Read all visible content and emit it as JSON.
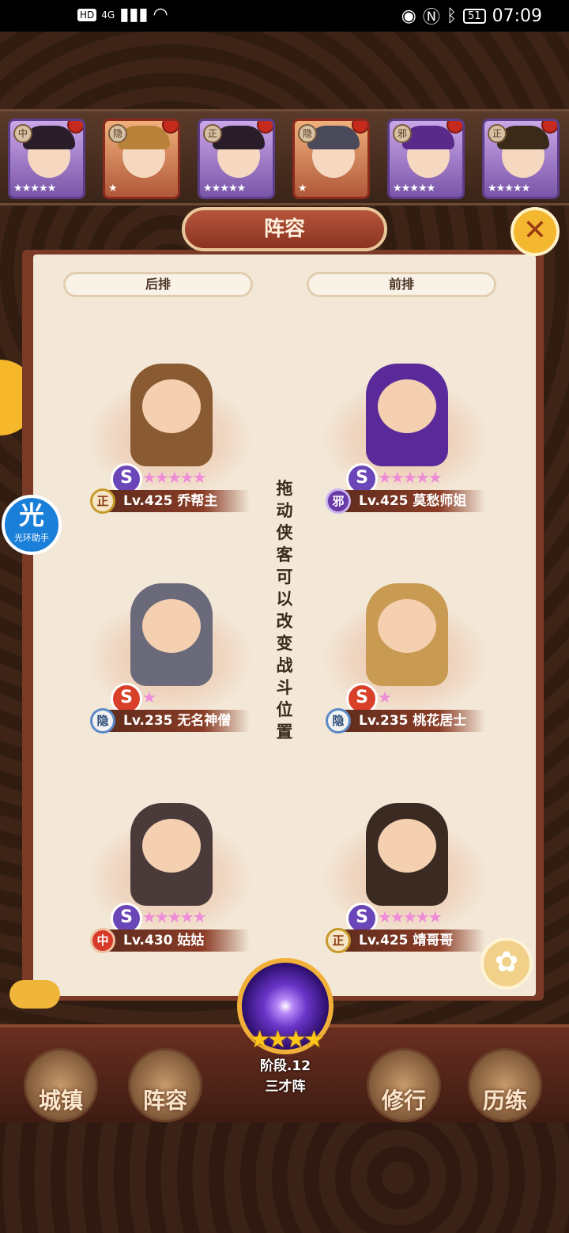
{
  "status": {
    "network_badge": "HD",
    "signal": "4G",
    "battery": "51",
    "time": "07:09"
  },
  "top_roster": [
    {
      "tag": "中",
      "stars": "★★★★★"
    },
    {
      "tag": "隐",
      "stars": "★"
    },
    {
      "tag": "正",
      "stars": "★★★★★"
    },
    {
      "tag": "隐",
      "stars": "★"
    },
    {
      "tag": "邪",
      "stars": "★★★★★"
    },
    {
      "tag": "正",
      "stars": "★★★★★"
    }
  ],
  "panel": {
    "title": "阵容",
    "back_row": "后排",
    "front_row": "前排",
    "drag_hint": "拖动侠客可以改变战斗位置"
  },
  "heroes": [
    {
      "faction": "正",
      "level_name": "Lv.425 乔帮主",
      "stars": "★★★★★"
    },
    {
      "faction": "邪",
      "level_name": "Lv.425 莫愁师姐",
      "stars": "★★★★★"
    },
    {
      "faction": "隐",
      "level_name": "Lv.235 无名神僧",
      "stars": "★"
    },
    {
      "faction": "隐",
      "level_name": "Lv.235 桃花居士",
      "stars": "★"
    },
    {
      "faction": "中",
      "level_name": "Lv.430 姑姑",
      "stars": "★★★★★"
    },
    {
      "faction": "正",
      "level_name": "Lv.425 靖哥哥",
      "stars": "★★★★★"
    }
  ],
  "helper": {
    "icon_char": "光",
    "label": "光环助手"
  },
  "formation": {
    "stars": "★★★★",
    "stage": "阶段.12",
    "name": "三才阵"
  },
  "bottom_nav": [
    {
      "label": "城镇"
    },
    {
      "label": "阵容"
    },
    {
      "label": "修行"
    },
    {
      "label": "历练"
    }
  ],
  "colors": {
    "panel_border": "#7a3a26",
    "paper": "#f3e8d8",
    "accent_gold": "#f4b730"
  }
}
